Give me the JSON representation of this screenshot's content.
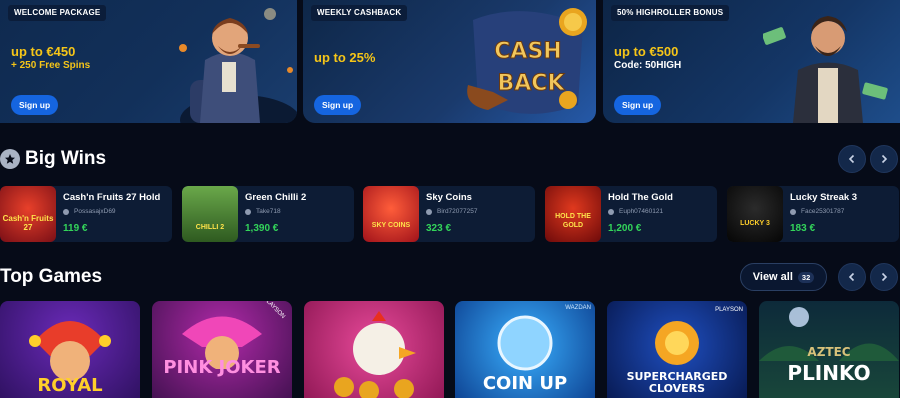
{
  "promos": [
    {
      "tag": "WELCOME PACKAGE",
      "line1": "up to €450",
      "line2": "+ 250 Free Spins",
      "button": "Sign up"
    },
    {
      "tag": "WEEKLY CASHBACK",
      "line1": "up to 25%",
      "line2": "",
      "button": "Sign up",
      "art_text_1": "CASH",
      "art_text_2": "BACK"
    },
    {
      "tag": "50% HIGHROLLER BONUS",
      "line1": "up to €500",
      "line2": "Code: 50HIGH",
      "button": "Sign up"
    }
  ],
  "big_wins": {
    "title": "Big Wins",
    "items": [
      {
        "game": "Cash'n Fruits 27 Hold",
        "user": "PossasajxD69",
        "amount": "119 €",
        "thumb_text": "Cash'n Fruits 27"
      },
      {
        "game": "Green Chilli 2",
        "user": "Take718",
        "amount": "1,390 €",
        "thumb_text": "CHILLI 2"
      },
      {
        "game": "Sky Coins",
        "user": "Bird72077257",
        "amount": "323 €",
        "thumb_text": "SKY COINS"
      },
      {
        "game": "Hold The Gold",
        "user": "Euph07460121",
        "amount": "1,200 €",
        "thumb_text": "HOLD THE GOLD"
      },
      {
        "game": "Lucky Streak 3",
        "user": "Face25301787",
        "amount": "183 €",
        "thumb_text": "LUCKY 3"
      }
    ]
  },
  "top_games": {
    "title": "Top Games",
    "view_all_label": "View all",
    "view_all_count": "32",
    "games": [
      {
        "title": "ROYAL",
        "bg": "#3a1a6e"
      },
      {
        "title": "PINK JOKER",
        "bg": "#5a1560",
        "provider": "PLAYSON"
      },
      {
        "title": "",
        "bg": "#b0276e"
      },
      {
        "title": "COIN UP",
        "bg": "#0f5fbf",
        "provider": "WAZDAN"
      },
      {
        "title": "SUPERCHARGED CLOVERS",
        "bg": "#0a2060",
        "provider": "PLAYSON"
      },
      {
        "title": "PLINKO",
        "subtitle": "AZTEC",
        "bg": "#113a3a"
      }
    ]
  },
  "colors": {
    "accent": "#1565e0",
    "gold": "#f5c518",
    "win_green": "#33d45a",
    "bg": "#060b18",
    "card": "#0d1c35"
  },
  "icons": [
    "star-icon",
    "chevron-left-icon",
    "chevron-right-icon",
    "user-icon"
  ]
}
